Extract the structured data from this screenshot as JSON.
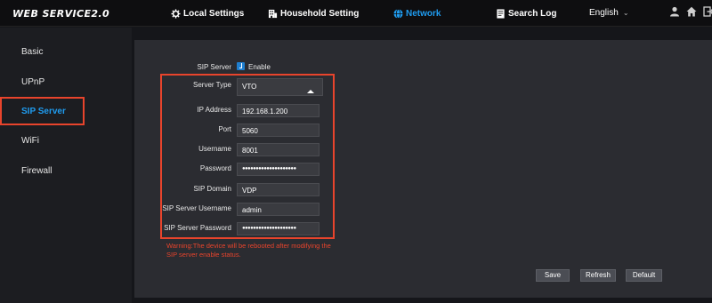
{
  "app": {
    "logo": "WEB SERVICE2.0"
  },
  "nav": {
    "items": [
      {
        "label": "Local Settings",
        "icon": "gear-icon",
        "active": false
      },
      {
        "label": "Household Setting",
        "icon": "building-icon",
        "active": false
      },
      {
        "label": "Network",
        "icon": "globe-icon",
        "active": true
      },
      {
        "label": "Search Log",
        "icon": "document-icon",
        "active": false
      }
    ],
    "language": "English",
    "icons": [
      "user-icon",
      "home-icon",
      "logout-icon"
    ],
    "active_color": "#1f9cf0"
  },
  "sidebar": {
    "items": [
      {
        "label": "Basic",
        "active": false
      },
      {
        "label": "UPnP",
        "active": false
      },
      {
        "label": "SIP Server",
        "active": true
      },
      {
        "label": "WiFi",
        "active": false
      },
      {
        "label": "Firewall",
        "active": false
      }
    ]
  },
  "form": {
    "sip_server_label": "SIP Server",
    "enable_label": "Enable",
    "enabled": true,
    "server_type_label": "Server Type",
    "server_type_value": "VTO",
    "ip_label": "IP Address",
    "ip_value": "192.168.1.200",
    "port_label": "Port",
    "port_value": "5060",
    "username_label": "Username",
    "username_value": "8001",
    "password_label": "Password",
    "password_value": "●●●●●●●●●●●●●●●●●●●●",
    "domain_label": "SIP Domain",
    "domain_value": "VDP",
    "server_username_label": "SIP Server Username",
    "server_username_value": "admin",
    "server_password_label": "SIP Server Password",
    "server_password_value": "●●●●●●●●●●●●●●●●●●●●",
    "warning_line1": "Warning:The device will be rebooted after modifying the",
    "warning_line2": "SIP server enable status."
  },
  "buttons": {
    "save": "Save",
    "refresh": "Refresh",
    "default": "Default"
  },
  "colors": {
    "highlight_border": "#e8442c",
    "warning": "#e8442c",
    "checkbox": "#1f7fd0"
  }
}
